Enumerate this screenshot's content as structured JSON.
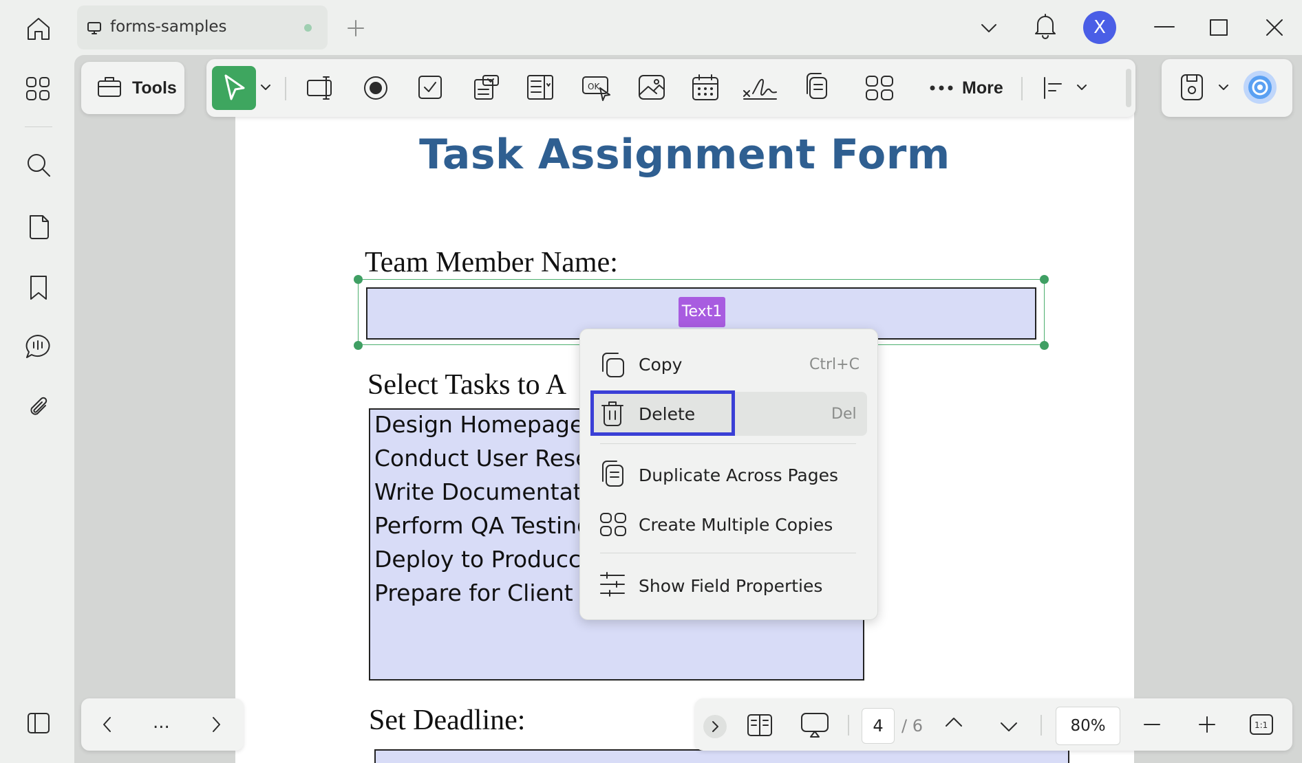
{
  "window": {
    "tab_title": "forms-samples",
    "avatar_initial": "X"
  },
  "toolbar": {
    "tools_label": "Tools",
    "more_label": "More"
  },
  "document": {
    "title": "Task Assignment Form",
    "name_label": "Team Member Name:",
    "field_tag": "Text1",
    "tasks_label": "Select Tasks to A",
    "tasks": [
      "Design Homepage",
      "Conduct User Resea",
      "Write Documentatic",
      "Perform QA Testing",
      "Deploy to Produccti",
      "Prepare for Client M"
    ],
    "deadline_label": "Set Deadline:"
  },
  "context_menu": {
    "items": [
      {
        "label": "Copy",
        "shortcut": "Ctrl+C",
        "icon": "copy-icon"
      },
      {
        "label": "Delete",
        "shortcut": "Del",
        "icon": "trash-icon"
      },
      {
        "label": "Duplicate Across Pages",
        "shortcut": "",
        "icon": "duplicate-pages-icon"
      },
      {
        "label": "Create Multiple Copies",
        "shortcut": "",
        "icon": "grid-copies-icon"
      },
      {
        "label": "Show Field Properties",
        "shortcut": "",
        "icon": "sliders-icon"
      }
    ]
  },
  "page_nav": {
    "current_page": "4",
    "total_pages": "/ 6",
    "zoom": "80%",
    "ellipsis": "..."
  },
  "colors": {
    "accent_green": "#3ea65f",
    "title_blue": "#2f5f91",
    "field_fill": "#d8dcf7",
    "highlight_blue": "#3a3fd6",
    "tag_purple": "#a85ce0"
  }
}
